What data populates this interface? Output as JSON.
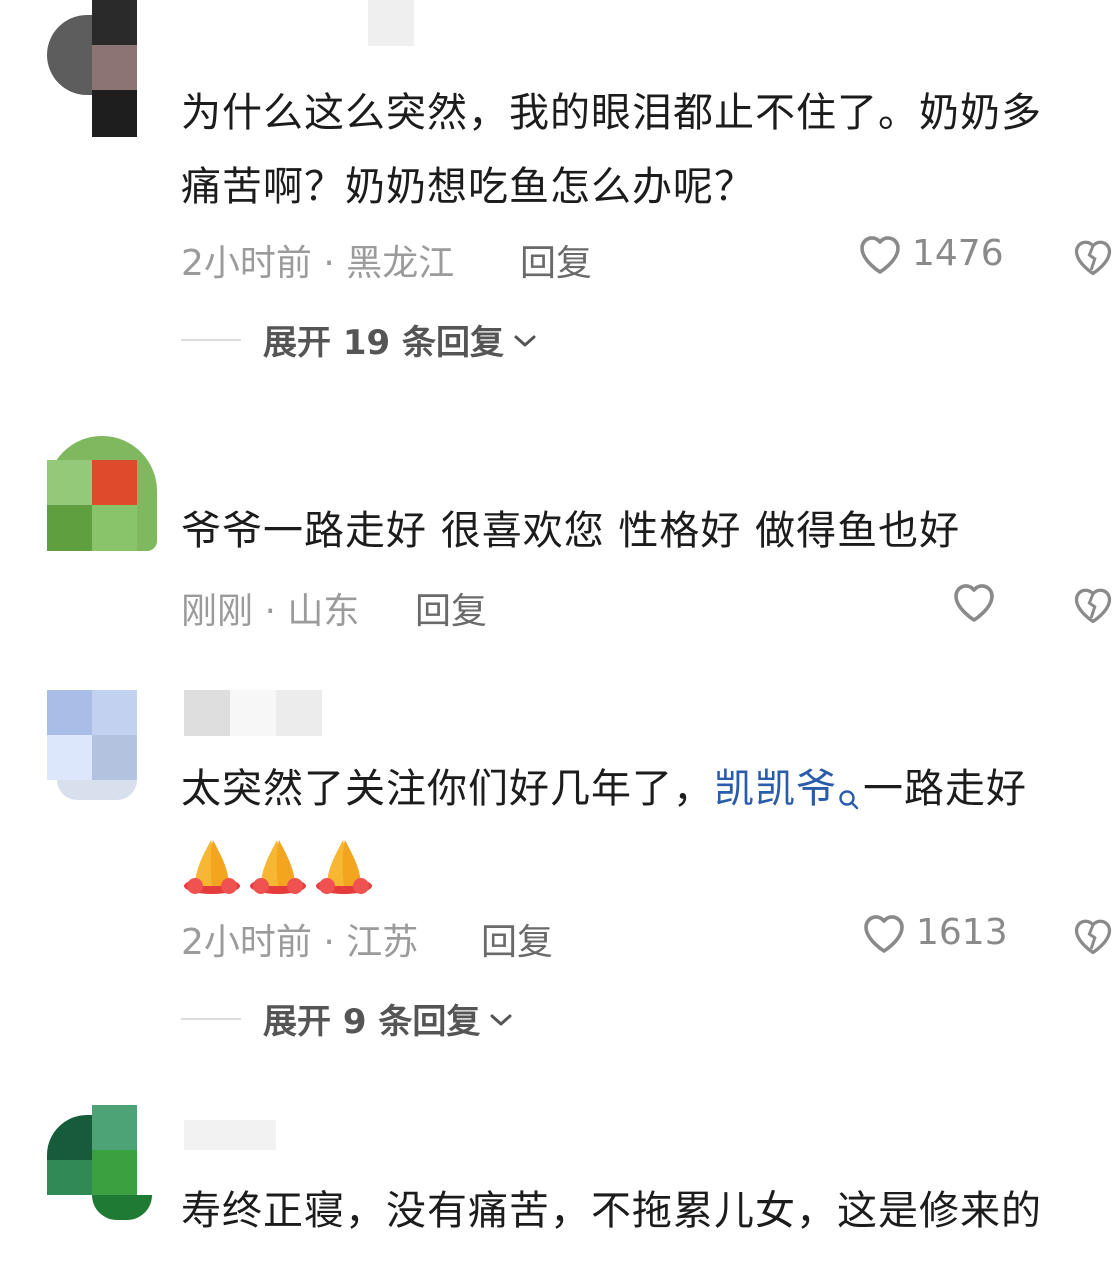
{
  "comments": [
    {
      "text_line1": "为什么这么突然，我的眼泪都止不住了。奶奶多",
      "text_line2": "痛苦啊？奶奶想吃鱼怎么办呢？",
      "meta": "2小时前 · 黑龙江",
      "reply_label": "回复",
      "like_count": "1476",
      "expand_label": "展开 19 条回复",
      "expand_icon": "chevron-down-icon"
    },
    {
      "text_line1": "爷爷一路走好  很喜欢您  性格好  做得鱼也好",
      "meta": "刚刚 · 山东",
      "reply_label": "回复",
      "like_count": ""
    },
    {
      "text_before_mention": "太突然了关注你们好几年了，",
      "mention": "凯凯爷",
      "text_after_mention": "一路走好",
      "emoji": [
        "folded-hands",
        "folded-hands",
        "folded-hands"
      ],
      "meta": "2小时前 · 江苏",
      "reply_label": "回复",
      "like_count": "1613",
      "expand_label": "展开 9 条回复",
      "expand_icon": "chevron-down-icon"
    },
    {
      "text_line1": "寿终正寝，没有痛苦，不拖累儿女，这是修来的"
    }
  ],
  "colors": {
    "meta_text": "#9b9b9b",
    "mention": "#2a5caa",
    "heart_outline": "#8a8a8a"
  }
}
